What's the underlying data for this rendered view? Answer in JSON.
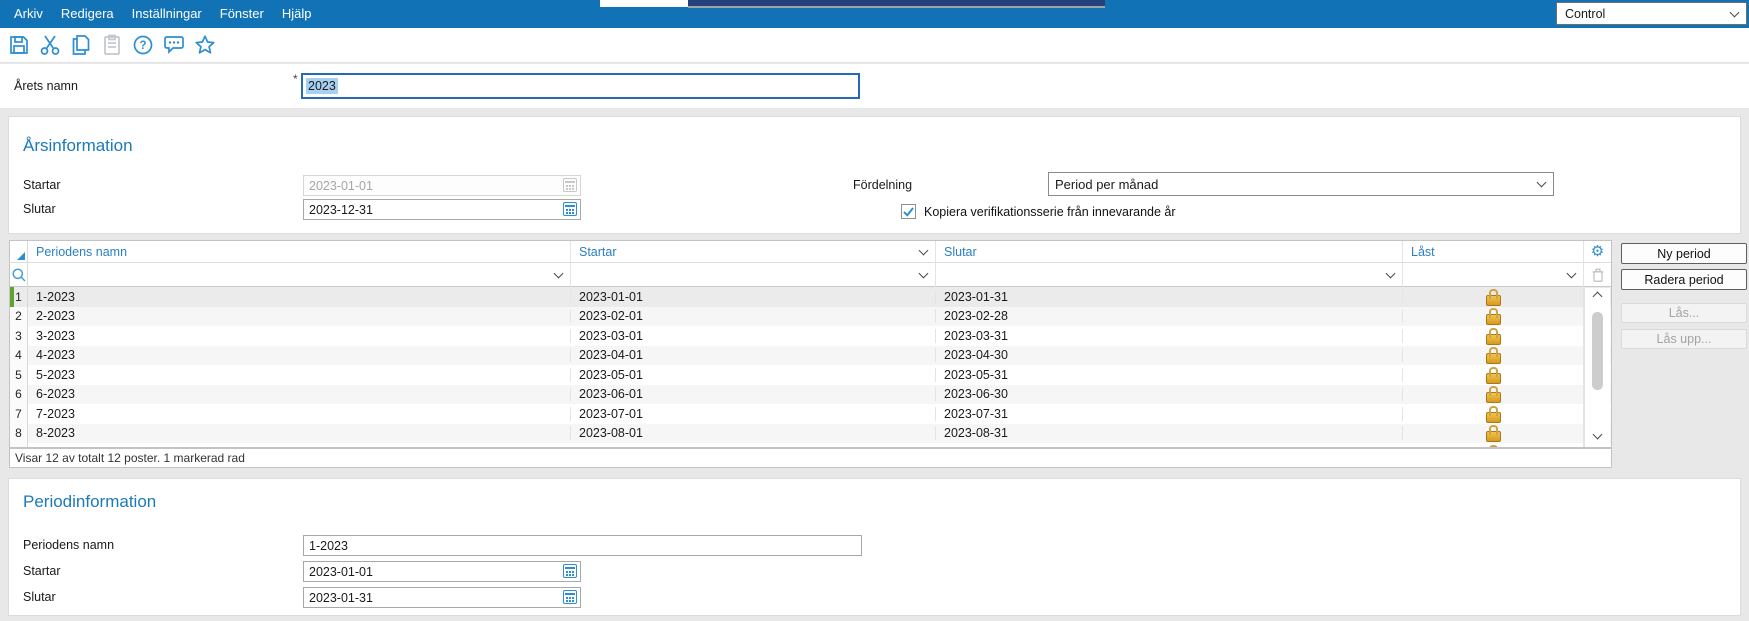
{
  "menubar": {
    "items": [
      "Arkiv",
      "Redigera",
      "Inställningar",
      "Fönster",
      "Hjälp"
    ],
    "app_select": {
      "value": "Control"
    }
  },
  "toolbar": {
    "icons": [
      {
        "name": "save-icon",
        "enabled": true
      },
      {
        "name": "cut-icon",
        "enabled": true
      },
      {
        "name": "copy-icon",
        "enabled": true
      },
      {
        "name": "paste-icon",
        "enabled": false
      },
      {
        "name": "help-icon",
        "enabled": true
      },
      {
        "name": "feedback-icon",
        "enabled": true
      },
      {
        "name": "favorite-star-icon",
        "enabled": true
      }
    ]
  },
  "year_form": {
    "name_label": "Årets namn",
    "required_marker": "*",
    "name_value": "2023"
  },
  "year_info": {
    "title": "Årsinformation",
    "start_label": "Startar",
    "start_value": "2023-01-01",
    "end_label": "Slutar",
    "end_value": "2023-12-31",
    "distribution_label": "Fördelning",
    "distribution_value": "Period per månad",
    "copy_checkbox_label": "Kopiera verifikationsserie från innevarande år",
    "copy_checkbox_checked": true
  },
  "periods_table": {
    "columns": [
      "Periodens namn",
      "Startar",
      "Slutar",
      "Låst"
    ],
    "rows": [
      {
        "num": "1",
        "name": "1-2023",
        "start": "2023-01-01",
        "end": "2023-01-31",
        "locked": true,
        "selected": true
      },
      {
        "num": "2",
        "name": "2-2023",
        "start": "2023-02-01",
        "end": "2023-02-28",
        "locked": true,
        "selected": false
      },
      {
        "num": "3",
        "name": "3-2023",
        "start": "2023-03-01",
        "end": "2023-03-31",
        "locked": true,
        "selected": false
      },
      {
        "num": "4",
        "name": "4-2023",
        "start": "2023-04-01",
        "end": "2023-04-30",
        "locked": true,
        "selected": false
      },
      {
        "num": "5",
        "name": "5-2023",
        "start": "2023-05-01",
        "end": "2023-05-31",
        "locked": true,
        "selected": false
      },
      {
        "num": "6",
        "name": "6-2023",
        "start": "2023-06-01",
        "end": "2023-06-30",
        "locked": true,
        "selected": false
      },
      {
        "num": "7",
        "name": "7-2023",
        "start": "2023-07-01",
        "end": "2023-07-31",
        "locked": true,
        "selected": false
      },
      {
        "num": "8",
        "name": "8-2023",
        "start": "2023-08-01",
        "end": "2023-08-31",
        "locked": true,
        "selected": false
      },
      {
        "num": "",
        "name": "",
        "start": "",
        "end": "",
        "locked": true,
        "selected": false
      }
    ],
    "status": "Visar 12 av totalt 12 poster. 1 markerad rad"
  },
  "table_actions": {
    "new": "Ny period",
    "delete": "Radera period",
    "lock": "Lås...",
    "unlock": "Lås upp..."
  },
  "period_info": {
    "title": "Periodinformation",
    "name_label": "Periodens namn",
    "name_value": "1-2023",
    "start_label": "Startar",
    "start_value": "2023-01-01",
    "end_label": "Slutar",
    "end_value": "2023-01-31"
  },
  "colors": {
    "menubar_blue": "#1173b5",
    "heading_blue": "#1b7ab8",
    "icon_blue": "#2e8fd0",
    "lock_gold": "#d89a1e",
    "selected_row_bar_green": "#5ea22f"
  }
}
